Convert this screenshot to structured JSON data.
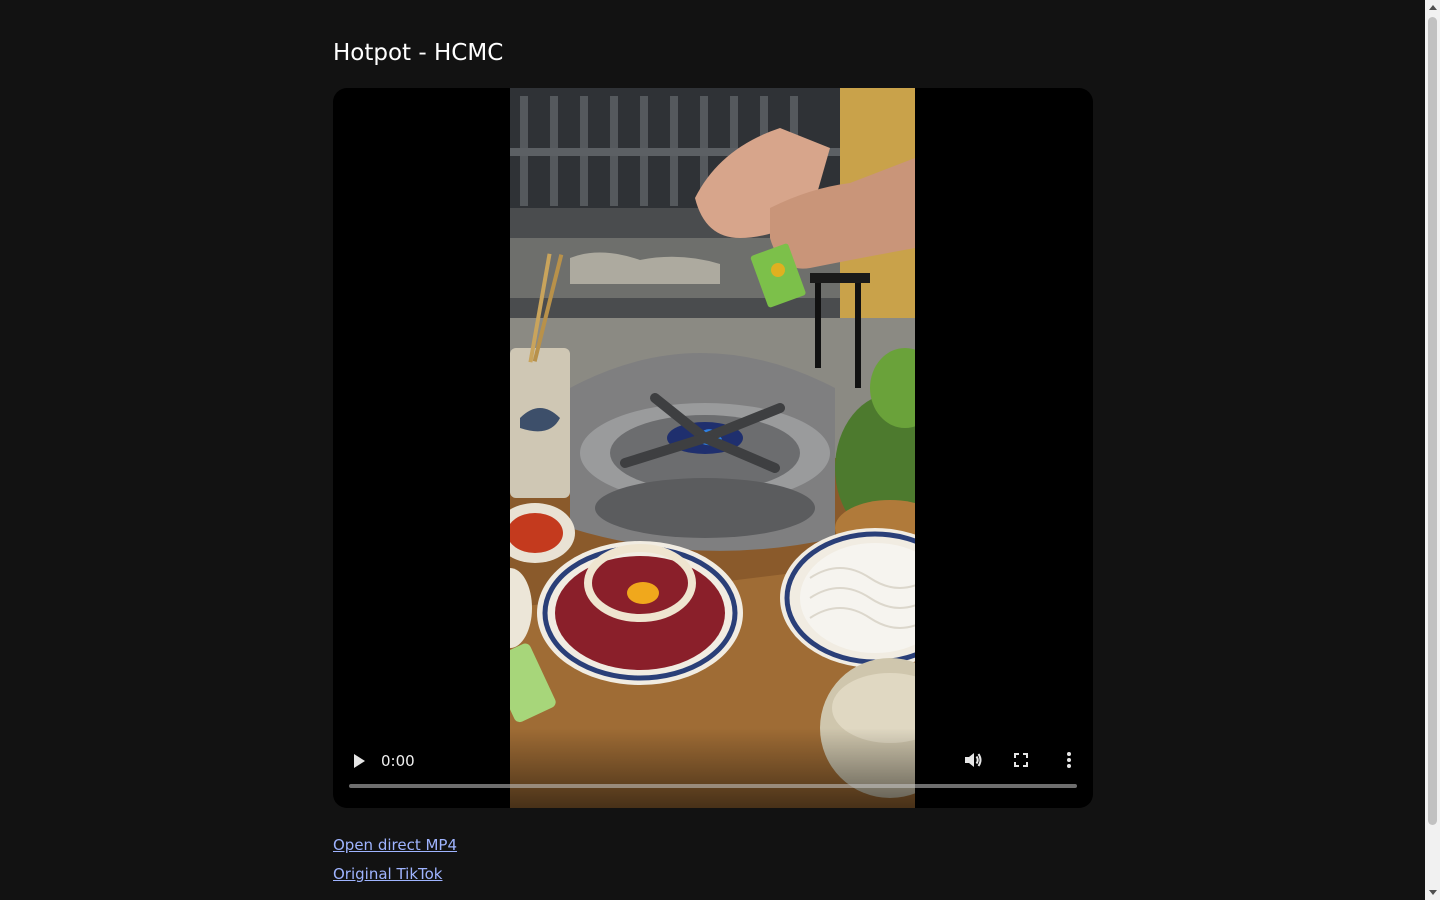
{
  "page": {
    "title": "Hotpot - HCMC"
  },
  "video": {
    "current_time": "0:00",
    "progress": 0,
    "icons": {
      "play": "play-icon",
      "volume": "volume-icon",
      "fullscreen": "fullscreen-icon",
      "more": "more-vertical-icon"
    }
  },
  "links": {
    "direct_mp4": "Open direct MP4",
    "original_tiktok": "Original TikTok"
  },
  "colors": {
    "background": "#121212",
    "link": "#9fb4ff",
    "player_background": "#000000"
  }
}
